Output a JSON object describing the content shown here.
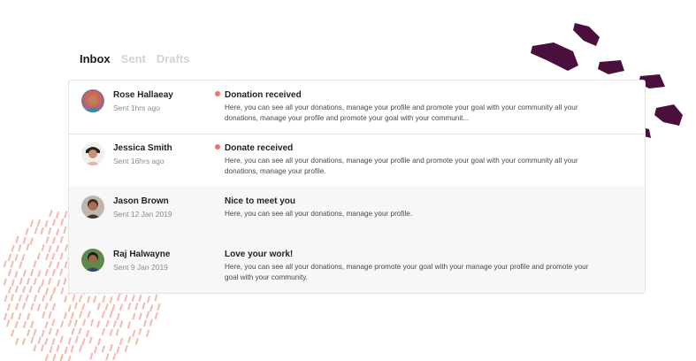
{
  "tabs": [
    {
      "label": "Inbox",
      "active": true
    },
    {
      "label": "Sent",
      "active": false
    },
    {
      "label": "Drafts",
      "active": false
    }
  ],
  "messages": [
    {
      "sender": "Rose Hallaeay",
      "time": "Sent 1hrs ago",
      "subject": "Donation received",
      "preview": "Here, you can see all your donations, manage your profile and promote your goal with your community all your donations, manage your profile and promote your goal with your communit...",
      "unread": true,
      "avatar": "avatar-rose"
    },
    {
      "sender": "Jessica Smith",
      "time": "Sent 16hrs ago",
      "subject": "Donate received",
      "preview": "Here, you can see all your donations, manage your profile and promote your goal with your community all your donations, manage your profile.",
      "unread": true,
      "avatar": "avatar-jessica"
    },
    {
      "sender": "Jason Brown",
      "time": "Sent 12 Jan 2019",
      "subject": "Nice to meet you",
      "preview": "Here, you can see all your donations, manage your profile.",
      "unread": false,
      "avatar": "avatar-jason"
    },
    {
      "sender": "Raj Halwayne",
      "time": "Sent 9 Jan 2019",
      "subject": "Love your work!",
      "preview": "Here, you can see all your donations, manage promote your goal with your manage your profile and promote your goal with your community.",
      "unread": false,
      "avatar": "avatar-raj"
    }
  ],
  "colors": {
    "unread_dot": "#f0735d",
    "decor_dashes": "#f4bdb1",
    "decor_brush": "#4a0f3d",
    "tab_inactive": "#d2d2d8",
    "read_row_bg": "#f7f7f8"
  }
}
